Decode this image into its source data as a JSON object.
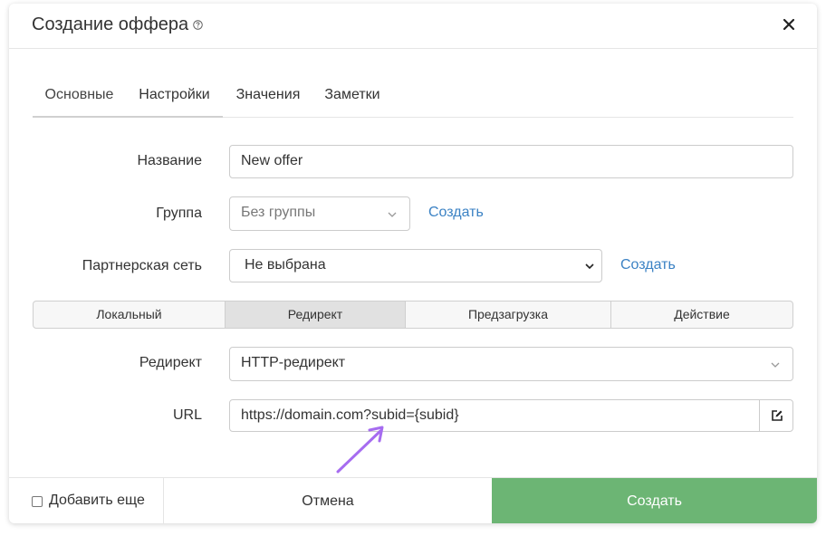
{
  "dialog": {
    "title": "Создание оффера",
    "help_icon": "question-circle-icon",
    "close_icon": "close-icon"
  },
  "tabs": [
    {
      "label": "Основные"
    },
    {
      "label": "Настройки"
    },
    {
      "label": "Значения"
    },
    {
      "label": "Заметки"
    }
  ],
  "form": {
    "name": {
      "label": "Название",
      "value": "New offer"
    },
    "group": {
      "label": "Группа",
      "value": "Без группы",
      "create_link": "Создать"
    },
    "network": {
      "label": "Партнерская сеть",
      "value": "Не выбрана",
      "create_link": "Создать"
    },
    "type_segments": [
      {
        "label": "Локальный",
        "selected": false
      },
      {
        "label": "Редирект",
        "selected": true
      },
      {
        "label": "Предзагрузка",
        "selected": false
      },
      {
        "label": "Действие",
        "selected": false
      }
    ],
    "redirect": {
      "label": "Редирект",
      "value": "HTTP-редирект"
    },
    "url": {
      "label": "URL",
      "value": "https://domain.com?subid={subid}",
      "edit_icon": "edit-icon"
    }
  },
  "footer": {
    "add_more_label": "Добавить еще",
    "cancel_label": "Отмена",
    "create_label": "Создать"
  },
  "colors": {
    "primary_green": "#6cb574",
    "link_blue": "#3b82c4",
    "annotation_arrow": "#a66cf0"
  }
}
